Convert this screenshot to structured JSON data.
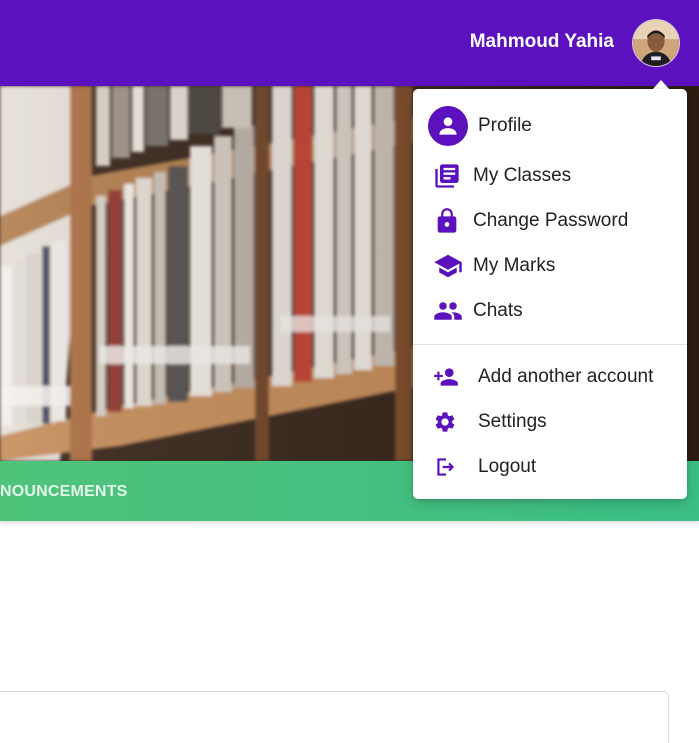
{
  "header": {
    "user_name": "Mahmoud Yahia",
    "background_color": "#5b12be"
  },
  "banner": {
    "strip_label": "NOUNCEMENTS",
    "strip_color": "#3bbf86"
  },
  "user_menu": {
    "accent_color": "#5b12be",
    "items": [
      {
        "label": "Profile",
        "icon": "account-circle-icon"
      },
      {
        "label": "My Classes",
        "icon": "library-books-icon"
      },
      {
        "label": "Change Password",
        "icon": "lock-icon"
      },
      {
        "label": "My Marks",
        "icon": "school-icon"
      },
      {
        "label": "Chats",
        "icon": "people-icon"
      },
      {
        "label": "Add another account",
        "icon": "person-add-icon"
      },
      {
        "label": "Settings",
        "icon": "gear-icon"
      },
      {
        "label": "Logout",
        "icon": "logout-icon"
      }
    ]
  }
}
